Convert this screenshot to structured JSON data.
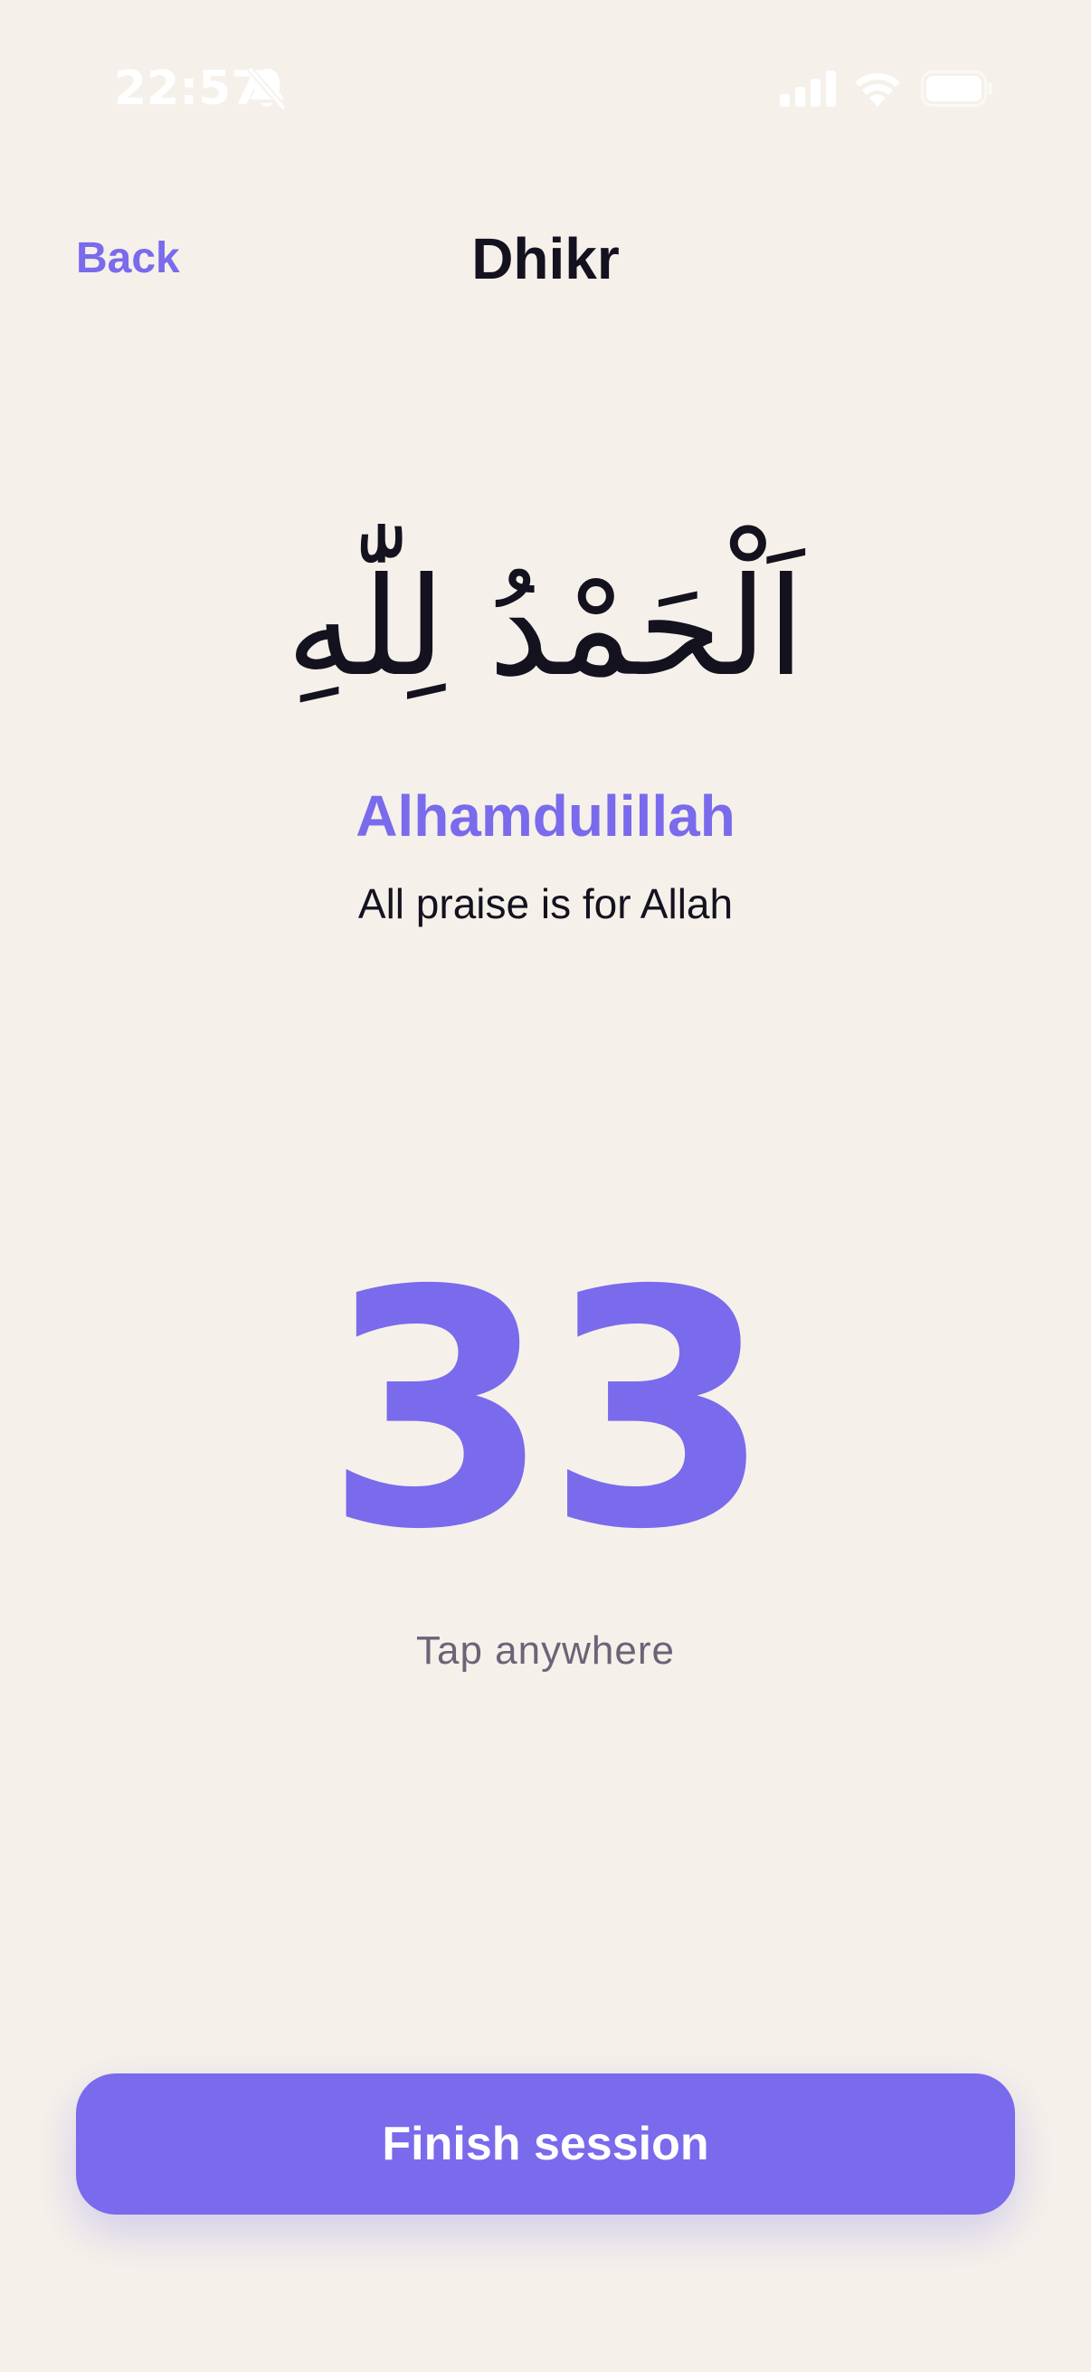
{
  "status_bar": {
    "time": "22:57",
    "icons": [
      "bell-slash-icon",
      "cellular-signal-icon",
      "wifi-icon",
      "battery-icon"
    ]
  },
  "nav": {
    "back_label": "Back",
    "title": "Dhikr"
  },
  "dhikr": {
    "arabic": "اَلْحَمْدُ لِلّٰهِ",
    "transliteration": "Alhamdulillah",
    "translation": "All praise is for Allah"
  },
  "counter": {
    "value": "33",
    "hint": "Tap anywhere"
  },
  "footer": {
    "finish_label": "Finish session"
  },
  "colors": {
    "background": "#F5F1EA",
    "accent": "#7A6AEC",
    "text_primary": "#14121F",
    "text_secondary": "#6B6478"
  }
}
